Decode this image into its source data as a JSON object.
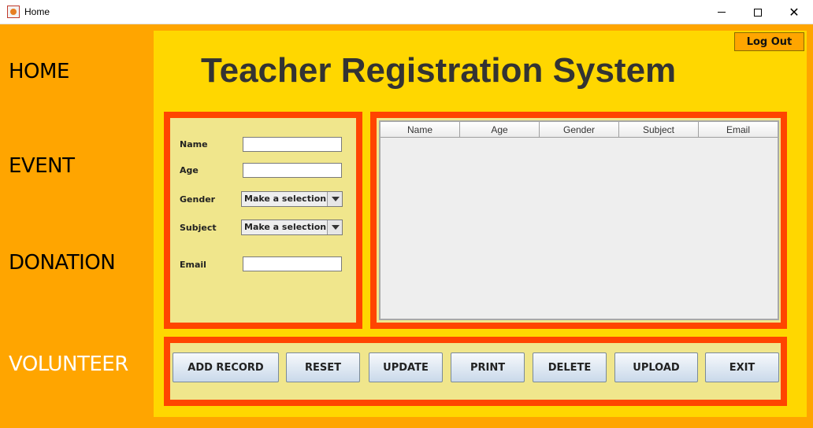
{
  "window": {
    "title": "Home",
    "icon": "java-cup-icon",
    "minimize_icon": "minimize-icon",
    "maximize_icon": "maximize-icon",
    "close_glyph": "✕"
  },
  "nav": {
    "items": [
      "HOME",
      "EVENT",
      "DONATION",
      "VOLUNTEER"
    ]
  },
  "header": {
    "logout_label": "Log Out",
    "title": "Teacher Registration System"
  },
  "form": {
    "name_label": "Name",
    "name_value": "",
    "age_label": "Age",
    "age_value": "",
    "gender_label": "Gender",
    "gender_selected": "Make a selection",
    "subject_label": "Subject",
    "subject_selected": "Make a selection",
    "email_label": "Email",
    "email_value": ""
  },
  "table": {
    "columns": [
      "Name",
      "Age",
      "Gender",
      "Subject",
      "Email"
    ],
    "rows": []
  },
  "actions": {
    "buttons": [
      "ADD RECORD",
      "RESET",
      "UPDATE",
      "PRINT",
      "DELETE",
      "UPLOAD",
      "EXIT"
    ]
  },
  "colors": {
    "sidebar": "#ffa500",
    "main": "#ffd700",
    "panel": "#f0e68c",
    "panel_border": "#ff4500",
    "title_text": "#333333"
  }
}
